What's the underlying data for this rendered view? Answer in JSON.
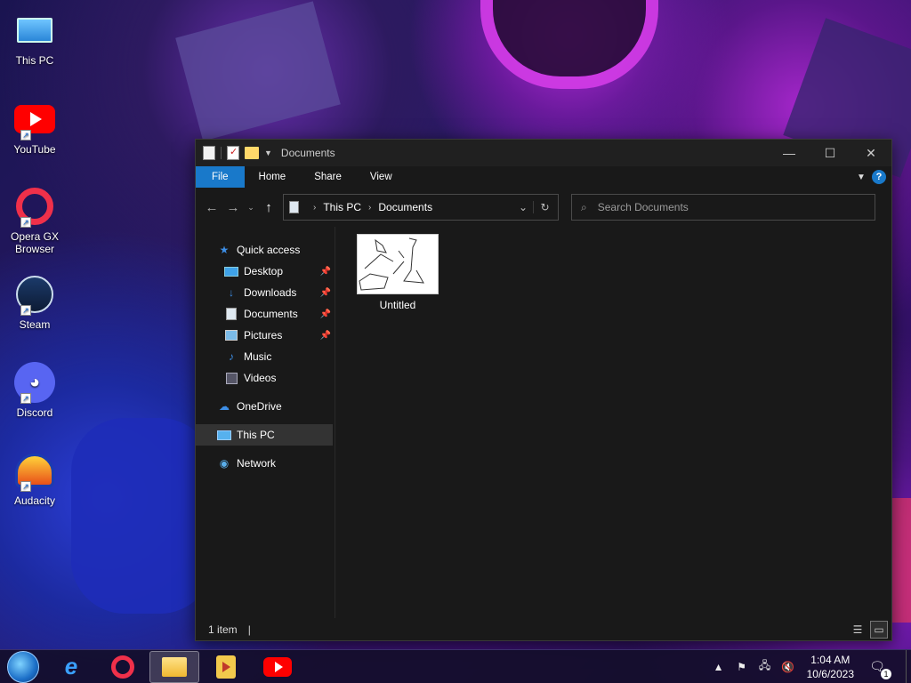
{
  "desktop": {
    "icons": [
      {
        "label": "This PC"
      },
      {
        "label": "YouTube"
      },
      {
        "label": "Opera GX Browser"
      },
      {
        "label": "Steam"
      },
      {
        "label": "Discord"
      },
      {
        "label": "Audacity"
      }
    ]
  },
  "window": {
    "title": "Documents",
    "controls": {
      "minimize": "—",
      "maximize": "☐",
      "close": "✕"
    },
    "ribbon": {
      "tabs": [
        "File",
        "Home",
        "Share",
        "View"
      ],
      "help": "?"
    },
    "nav": {
      "back": "←",
      "forward": "→",
      "recent": "⌄",
      "up": "↑"
    },
    "address": {
      "crumbs": [
        "This PC",
        "Documents"
      ]
    },
    "search": {
      "placeholder": "Search Documents"
    },
    "sidebar": {
      "quick_access": "Quick access",
      "items": [
        {
          "label": "Desktop",
          "pinned": true
        },
        {
          "label": "Downloads",
          "pinned": true
        },
        {
          "label": "Documents",
          "pinned": true
        },
        {
          "label": "Pictures",
          "pinned": true
        },
        {
          "label": "Music",
          "pinned": false
        },
        {
          "label": "Videos",
          "pinned": false
        }
      ],
      "onedrive": "OneDrive",
      "this_pc": "This PC",
      "network": "Network"
    },
    "files": [
      {
        "name": "Untitled",
        "type": "image"
      }
    ],
    "status": {
      "count": "1 item"
    }
  },
  "taskbar": {
    "clock_time": "1:04 AM",
    "clock_date": "10/6/2023",
    "notification_count": "1"
  },
  "colors": {
    "accent": "#1979ca",
    "window_bg": "#191919",
    "titlebar_bg": "#202020"
  }
}
